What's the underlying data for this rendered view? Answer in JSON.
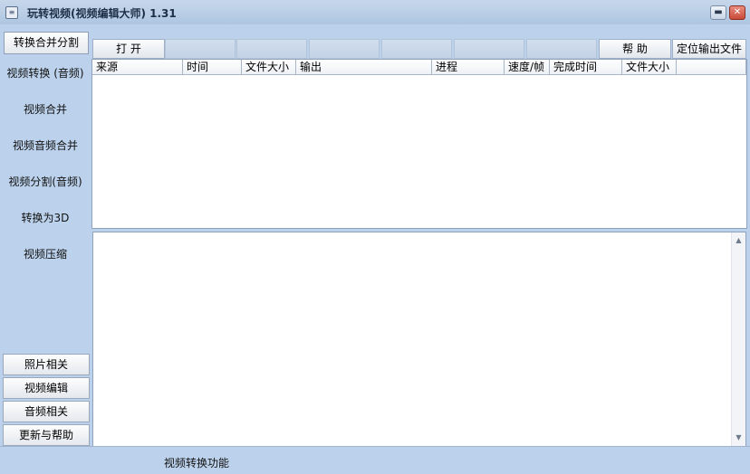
{
  "window": {
    "title": "玩转视频(视频编辑大师) 1.31",
    "app_icon": "menu-icon",
    "min_icon": "minimize-icon",
    "close_icon": "close-icon"
  },
  "sidebar": {
    "top_button": "转换合并分割",
    "items": [
      "视频转换 (音频)",
      "视频合并",
      "视频音频合并",
      "视频分割(音频)",
      "转换为3D",
      "视频压缩"
    ],
    "bottom_buttons": [
      "照片相关",
      "视频编辑",
      "音频相关",
      "更新与帮助"
    ]
  },
  "toolbar": {
    "open_label": "打 开",
    "help_label": "帮 助",
    "locate_label": "定位输出文件"
  },
  "table": {
    "columns": [
      "来源",
      "时间",
      "文件大小",
      "输出",
      "进程",
      "速度/帧",
      "完成时间",
      "文件大小"
    ]
  },
  "status": {
    "text": "视频转换功能"
  }
}
